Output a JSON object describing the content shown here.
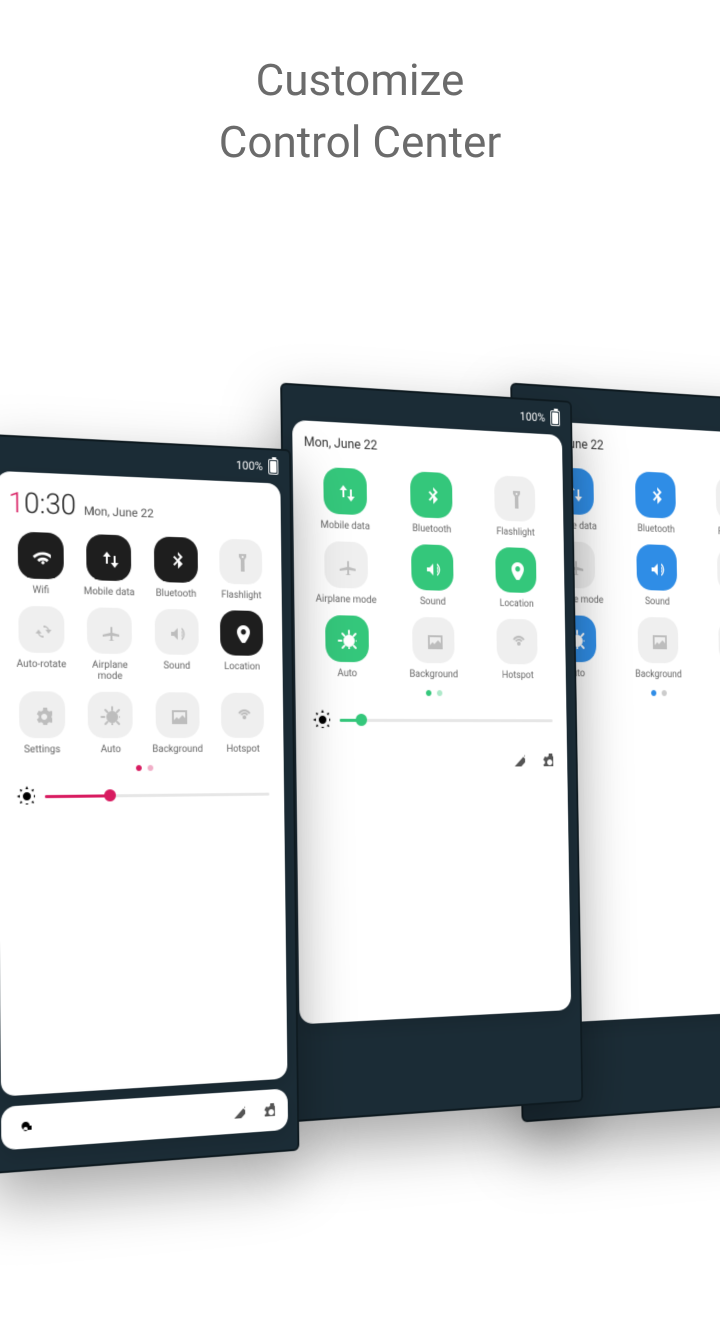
{
  "heading": {
    "line1": "Customize",
    "line2": "Control Center"
  },
  "status": {
    "battery": "100%"
  },
  "clock": {
    "h": "1",
    "m": "0:30"
  },
  "date": "Mon, June 22",
  "tiles": {
    "wifi": "Wifi",
    "mobiledata": "Mobile data",
    "bluetooth": "Bluetooth",
    "flashlight": "Flashlight",
    "autorotate": "Auto-rotate",
    "airplane": "Airplane mode",
    "sound": "Sound",
    "location": "Location",
    "settings": "Settings",
    "auto": "Auto",
    "background": "Background",
    "hotspot": "Hotspot"
  },
  "themes": {
    "black": {
      "on": [
        "wifi",
        "mobiledata",
        "bluetooth",
        "location"
      ],
      "off": [
        "flashlight",
        "autorotate",
        "airplane",
        "sound",
        "settings",
        "auto",
        "background",
        "hotspot"
      ]
    },
    "green": {
      "on": [
        "mobiledata",
        "bluetooth",
        "sound",
        "location",
        "auto"
      ],
      "off": [
        "flashlight",
        "airplane",
        "background",
        "hotspot"
      ]
    },
    "blue": {
      "on": [
        "mobiledata",
        "bluetooth",
        "sound",
        "auto"
      ],
      "off": [
        "flashlight",
        "airplane",
        "location",
        "background",
        "hotspot"
      ]
    }
  },
  "slider": {
    "brightness_pct": 28
  },
  "colors": {
    "black": "#1e1e1e",
    "green": "#34c77b",
    "blue": "#2f8de6",
    "accent_red": "#d81b60"
  }
}
